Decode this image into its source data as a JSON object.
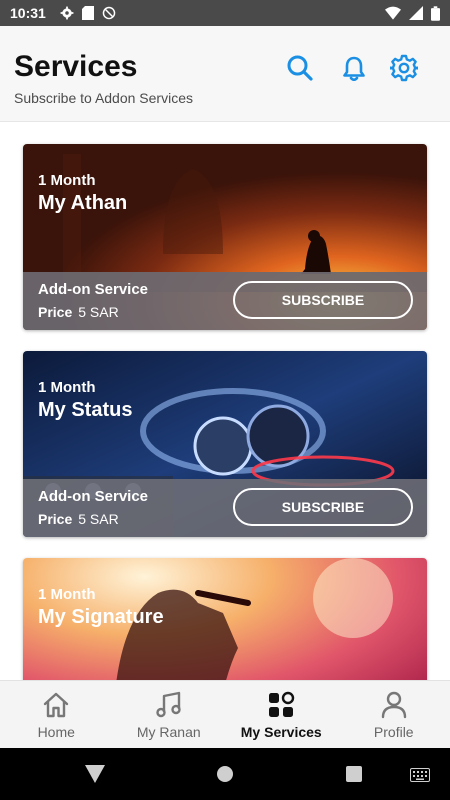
{
  "status_bar": {
    "time": "10:31",
    "icons_left": [
      "gear-icon",
      "sd-card-icon",
      "do-not-disturb-icon"
    ],
    "icons_right": [
      "wifi-icon",
      "signal-icon",
      "battery-icon"
    ]
  },
  "header": {
    "title": "Services",
    "subtitle": "Subscribe to Addon Services",
    "accent_color": "#1a8fe3"
  },
  "services": [
    {
      "duration": "1 Month",
      "name": "My Athan",
      "type_label": "Add-on Service",
      "price_label": "Price",
      "price": "5 SAR",
      "button_label": "SUBSCRIBE"
    },
    {
      "duration": "1 Month",
      "name": "My Status",
      "type_label": "Add-on Service",
      "price_label": "Price",
      "price": "5 SAR",
      "button_label": "SUBSCRIBE"
    },
    {
      "duration": "1 Month",
      "name": "My Signature"
    }
  ],
  "bottom_nav": {
    "items": [
      {
        "label": "Home",
        "icon": "home-icon",
        "active": false
      },
      {
        "label": "My Ranan",
        "icon": "music-note-icon",
        "active": false
      },
      {
        "label": "My Services",
        "icon": "services-grid-icon",
        "active": true
      },
      {
        "label": "Profile",
        "icon": "profile-icon",
        "active": false
      }
    ]
  },
  "system_nav": [
    "back-icon",
    "home-circle-icon",
    "recents-icon",
    "keyboard-icon"
  ]
}
